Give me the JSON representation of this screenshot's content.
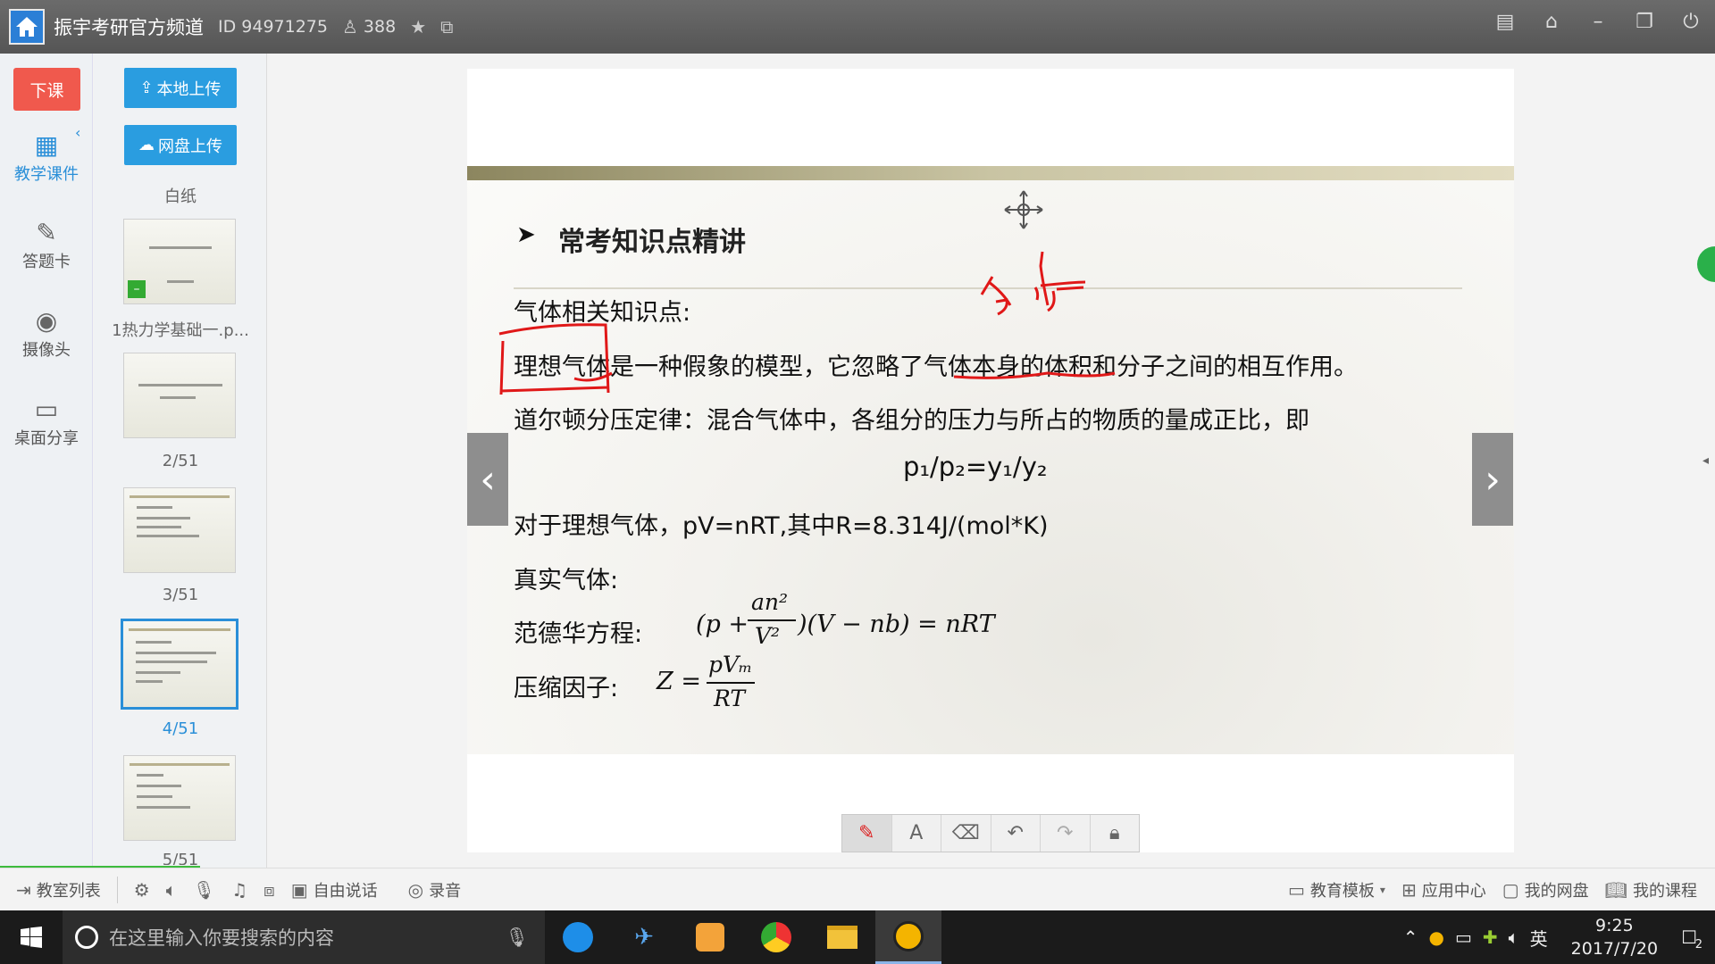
{
  "titlebar": {
    "channel": "振宇考研官方频道",
    "id": "ID 94971275",
    "viewers": "388"
  },
  "left_rail": {
    "end_class": "下课",
    "items": [
      {
        "label": "教学课件",
        "icon": "courseware-icon"
      },
      {
        "label": "答题卡",
        "icon": "answer-card-icon"
      },
      {
        "label": "摄像头",
        "icon": "camera-icon"
      },
      {
        "label": "桌面分享",
        "icon": "desktop-share-icon"
      }
    ]
  },
  "thumbs": {
    "upload_local": "本地上传",
    "upload_cloud": "网盘上传",
    "blank": "白纸",
    "labels": [
      "1热力学基础一.p...",
      "2/51",
      "3/51",
      "4/51",
      "5/51"
    ]
  },
  "slide": {
    "heading": "常考知识点精讲",
    "line1": "气体相关知识点:",
    "line2": "理想气体是一种假象的模型，它忽略了气体本身的体积和分子之间的相互作用。",
    "line3": "道尔顿分压定律：混合气体中，各组分的压力与所占的物质的量成正比，即",
    "formula1": "p₁/p₂=y₁/y₂",
    "line4": "对于理想气体，pV=nRT,其中R=8.314J/(mol*K)",
    "line5": "真实气体:",
    "line6_label": "范德华方程:",
    "vdw_left": "(p +",
    "vdw_num": "an²",
    "vdw_den": "V²",
    "vdw_right": ")(V − nb) = nRT",
    "line7_label": "压缩因子:",
    "z_left": "Z =",
    "z_num": "pVₘ",
    "z_den": "RT",
    "annotation": "分子"
  },
  "bottom_bar": {
    "classroom_list": "教室列表",
    "free_talk": "自由说话",
    "record": "录音",
    "edu_template": "教育模板",
    "app_center": "应用中心",
    "my_cloud": "我的网盘",
    "my_course": "我的课程"
  },
  "taskbar": {
    "search_placeholder": "在这里输入你要搜索的内容",
    "time": "9:25",
    "date": "2017/7/20",
    "ime": "英",
    "notify_count": "2"
  }
}
